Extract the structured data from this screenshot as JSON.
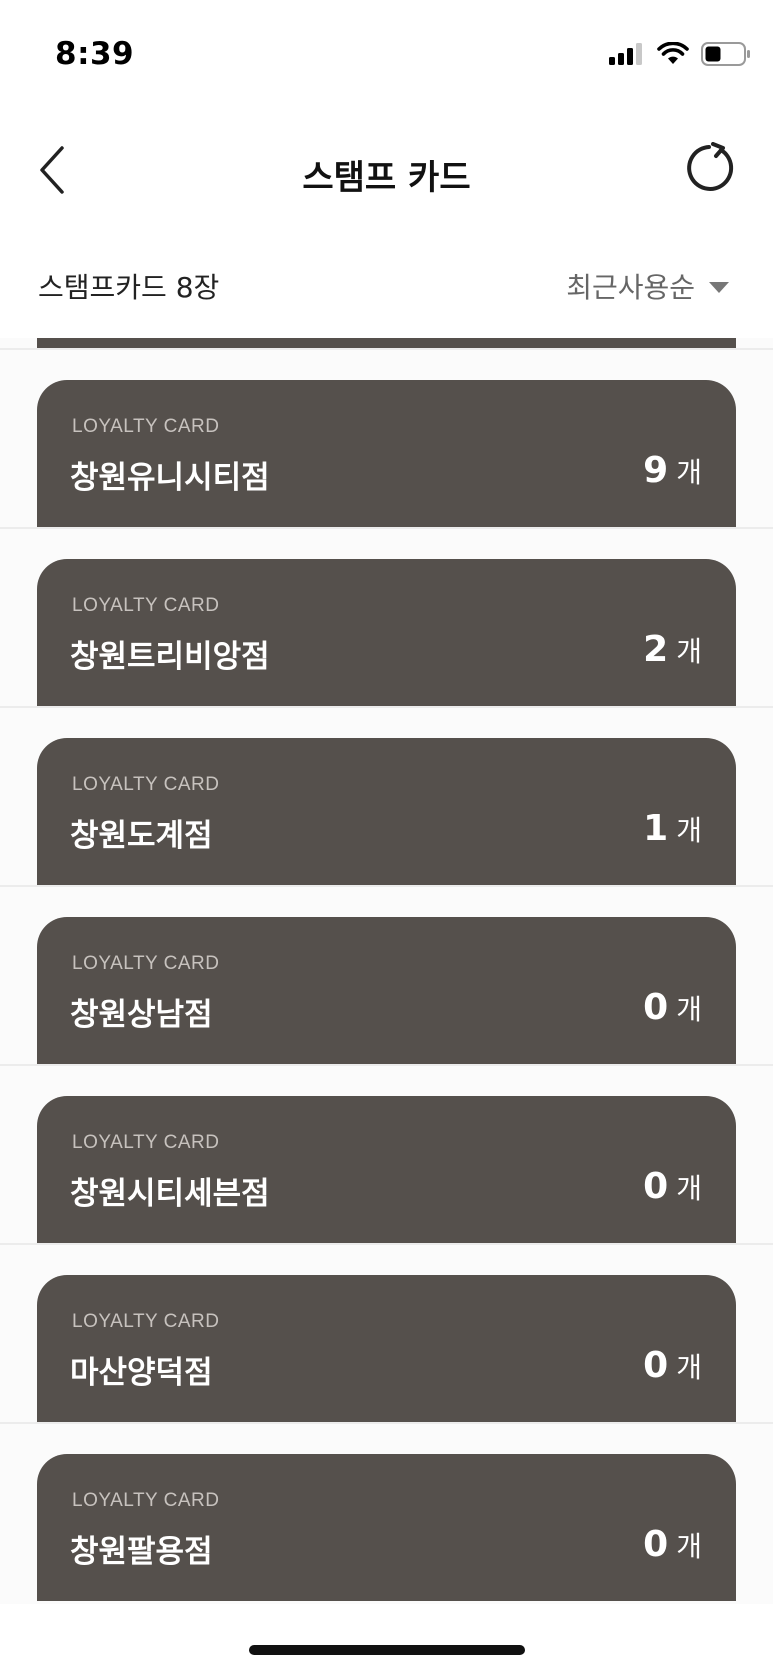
{
  "status_bar": {
    "time": "8:39",
    "icons": [
      "cellular-signal-icon",
      "wifi-icon",
      "battery-icon"
    ]
  },
  "nav": {
    "title": "스탬프 카드",
    "back_icon": "chevron-left-icon",
    "refresh_icon": "refresh-icon"
  },
  "list_header": {
    "count_label": "스탬프카드 8장",
    "sort_label": "최근사용순",
    "sort_icon": "caret-down-icon"
  },
  "cards": [
    {
      "label": "LOYALTY CARD",
      "store": "창원유니시티점",
      "stamps": "9",
      "unit": "개"
    },
    {
      "label": "LOYALTY CARD",
      "store": "창원트리비앙점",
      "stamps": "2",
      "unit": "개"
    },
    {
      "label": "LOYALTY CARD",
      "store": "창원도계점",
      "stamps": "1",
      "unit": "개"
    },
    {
      "label": "LOYALTY CARD",
      "store": "창원상남점",
      "stamps": "0",
      "unit": "개"
    },
    {
      "label": "LOYALTY CARD",
      "store": "창원시티세븐점",
      "stamps": "0",
      "unit": "개"
    },
    {
      "label": "LOYALTY CARD",
      "store": "마산양덕점",
      "stamps": "0",
      "unit": "개"
    },
    {
      "label": "LOYALTY CARD",
      "store": "창원팔용점",
      "stamps": "0",
      "unit": "개"
    }
  ],
  "colors": {
    "card_background": "#55504c",
    "card_label": "#c7c2be",
    "card_text": "#ffffff",
    "sort_text": "#666666"
  }
}
